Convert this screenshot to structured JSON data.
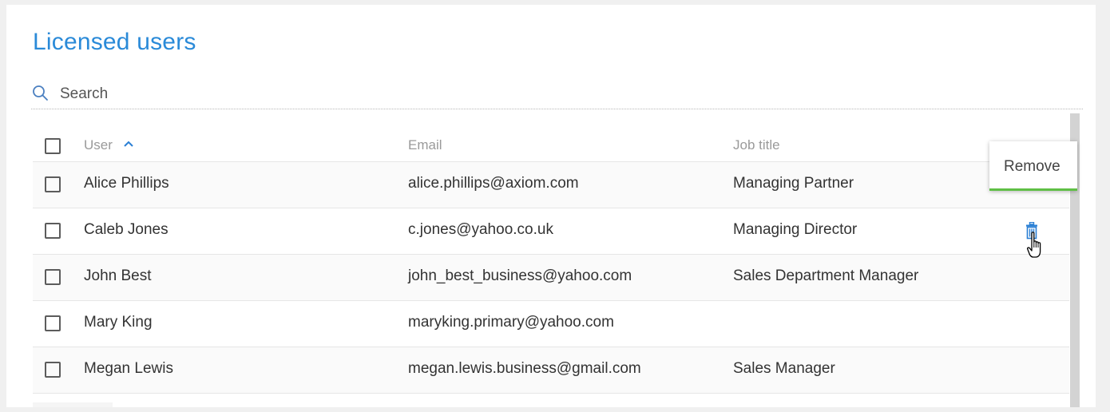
{
  "page": {
    "title": "Licensed users"
  },
  "search": {
    "placeholder": "Search"
  },
  "table": {
    "columns": {
      "user": "User",
      "email": "Email",
      "job_title": "Job title"
    },
    "rows": [
      {
        "user": "Alice Phillips",
        "email": "alice.phillips@axiom.com",
        "job_title": "Managing Partner"
      },
      {
        "user": "Caleb Jones",
        "email": "c.jones@yahoo.co.uk",
        "job_title": "Managing Director"
      },
      {
        "user": "John Best",
        "email": "john_best_business@yahoo.com",
        "job_title": "Sales Department Manager"
      },
      {
        "user": "Mary King",
        "email": "maryking.primary@yahoo.com",
        "job_title": ""
      },
      {
        "user": "Megan Lewis",
        "email": "megan.lewis.business@gmail.com",
        "job_title": "Sales Manager"
      }
    ]
  },
  "tooltip": {
    "text": "Remove"
  },
  "icons": {
    "search": "search-icon",
    "sort": "chevron-up-icon",
    "delete": "trash-icon",
    "cursor": "hand-pointer-icon"
  },
  "colors": {
    "title": "#2a8ad8",
    "accent": "#5fbf45",
    "icon": "#2a7fd4"
  }
}
